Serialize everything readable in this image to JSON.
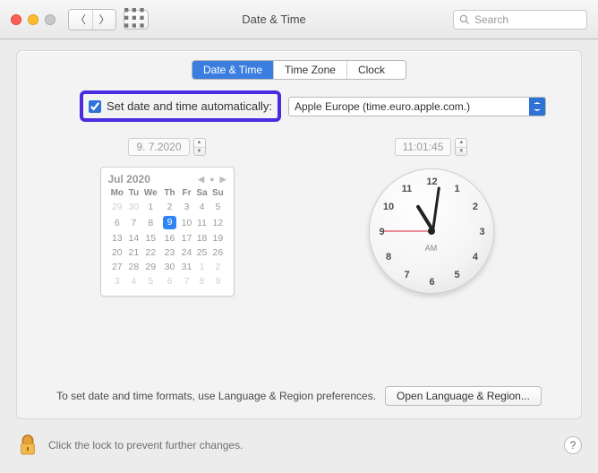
{
  "window": {
    "title": "Date & Time",
    "search_placeholder": "Search"
  },
  "tabs": {
    "date_time": "Date & Time",
    "time_zone": "Time Zone",
    "clock": "Clock",
    "active": 0
  },
  "auto": {
    "checked": true,
    "label": "Set date and time automatically:",
    "server": "Apple Europe (time.euro.apple.com.)"
  },
  "date": {
    "value": "9.  7.2020",
    "month_label": "Jul 2020",
    "weekdays": [
      "Mo",
      "Tu",
      "We",
      "Th",
      "Fr",
      "Sa",
      "Su"
    ],
    "cells": [
      [
        {
          "d": "29",
          "o": true
        },
        {
          "d": "30",
          "o": true
        },
        {
          "d": "1"
        },
        {
          "d": "2"
        },
        {
          "d": "3"
        },
        {
          "d": "4"
        },
        {
          "d": "5"
        }
      ],
      [
        {
          "d": "6"
        },
        {
          "d": "7"
        },
        {
          "d": "8"
        },
        {
          "d": "9",
          "sel": true
        },
        {
          "d": "10"
        },
        {
          "d": "11"
        },
        {
          "d": "12"
        }
      ],
      [
        {
          "d": "13"
        },
        {
          "d": "14"
        },
        {
          "d": "15"
        },
        {
          "d": "16"
        },
        {
          "d": "17"
        },
        {
          "d": "18"
        },
        {
          "d": "19"
        }
      ],
      [
        {
          "d": "20"
        },
        {
          "d": "21"
        },
        {
          "d": "22"
        },
        {
          "d": "23"
        },
        {
          "d": "24"
        },
        {
          "d": "25"
        },
        {
          "d": "26"
        }
      ],
      [
        {
          "d": "27"
        },
        {
          "d": "28"
        },
        {
          "d": "29"
        },
        {
          "d": "30"
        },
        {
          "d": "31"
        },
        {
          "d": "1",
          "o": true
        },
        {
          "d": "2",
          "o": true
        }
      ],
      [
        {
          "d": "3",
          "o": true
        },
        {
          "d": "4",
          "o": true
        },
        {
          "d": "5",
          "o": true
        },
        {
          "d": "6",
          "o": true
        },
        {
          "d": "7",
          "o": true
        },
        {
          "d": "8",
          "o": true
        },
        {
          "d": "9",
          "o": true
        }
      ]
    ]
  },
  "time": {
    "value": "11:01:45",
    "ampm": "AM",
    "numerals": [
      "12",
      "1",
      "2",
      "3",
      "4",
      "5",
      "6",
      "7",
      "8",
      "9",
      "10",
      "11"
    ]
  },
  "footer": {
    "hint": "To set date and time formats, use Language & Region preferences.",
    "open_btn": "Open Language & Region..."
  },
  "lock": {
    "text": "Click the lock to prevent further changes."
  }
}
